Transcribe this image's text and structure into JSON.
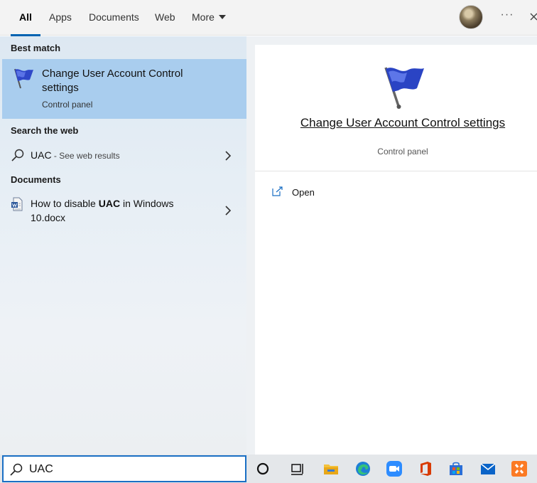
{
  "tabs": [
    {
      "label": "All",
      "active": true
    },
    {
      "label": "Apps"
    },
    {
      "label": "Documents"
    },
    {
      "label": "Web"
    },
    {
      "label": "More"
    }
  ],
  "more_options": "···",
  "sections": {
    "best_match": "Best match",
    "search_web": "Search the web",
    "documents": "Documents"
  },
  "best_match": {
    "title": "Change User Account Control settings",
    "subtitle": "Control panel",
    "icon": "uac-flag-icon"
  },
  "web_result": {
    "query": "UAC",
    "suffix": " - See web results",
    "icon": "search-icon"
  },
  "document_result": {
    "before": "How to disable ",
    "bold": "UAC",
    "after": " in Windows 10.docx",
    "icon": "docx-file-icon"
  },
  "detail": {
    "title": "Change User Account Control settings",
    "subtitle": "Control panel",
    "actions": [
      {
        "label": "Open",
        "icon": "open-icon"
      }
    ]
  },
  "search": {
    "value": "UAC"
  },
  "taskbar_icons": [
    "cortana-icon",
    "task-view-icon",
    "file-explorer-icon",
    "edge-icon",
    "zoom-icon",
    "office-icon",
    "store-icon",
    "mail-icon",
    "xampp-icon"
  ],
  "colors": {
    "accent": "#0063b1",
    "selection": "#a9cdee",
    "search_border": "#1a6fc4"
  }
}
